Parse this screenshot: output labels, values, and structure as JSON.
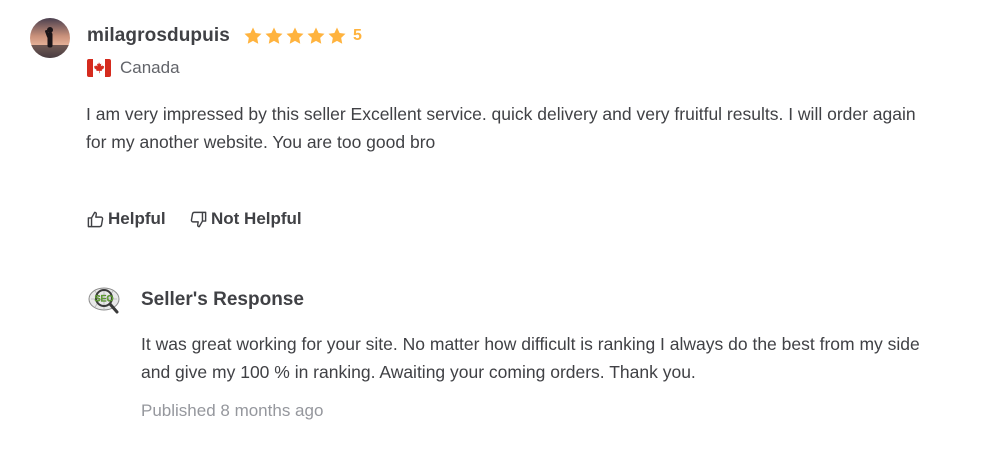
{
  "review": {
    "username": "milagrosdupuis",
    "rating": "5",
    "star_count": 5,
    "country": "Canada",
    "text": "I am very impressed by this seller Excellent service. quick delivery and very fruitful results. I will order again for my another website. You are too good bro"
  },
  "votes": {
    "helpful_label": "Helpful",
    "not_helpful_label": "Not Helpful"
  },
  "seller_response": {
    "heading": "Seller's Response",
    "logo_text": "SEO",
    "text": "It was great working for your site. No matter how difficult is ranking I always do the best from my side and give my 100 % in ranking. Awaiting your coming orders. Thank you.",
    "published": "Published 8 months ago"
  },
  "icons": {
    "star": "star-icon",
    "helpful": "thumbs-up-icon",
    "not_helpful": "thumbs-down-icon",
    "flag": "canada-flag-icon"
  },
  "colors": {
    "star": "#ffb33e",
    "text": "#404145",
    "muted": "#95979d",
    "flag_red": "#d52b1e"
  }
}
